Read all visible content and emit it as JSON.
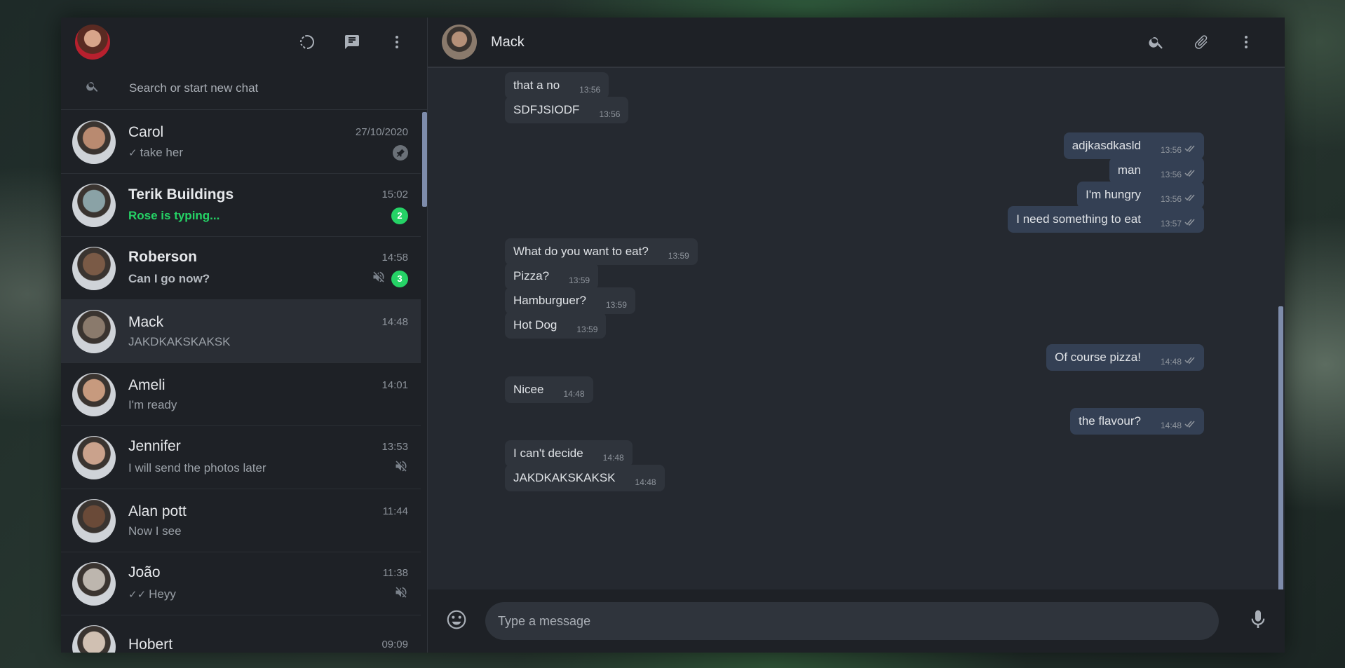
{
  "left": {
    "search_placeholder": "Search or start new chat",
    "chats": [
      {
        "name": "Carol",
        "time": "27/10/2020",
        "preview": "take her",
        "tick": "✓",
        "pinned": true,
        "color": "#b98a70"
      },
      {
        "name": "Terik Buildings",
        "time": "15:02",
        "preview": "Rose is typing...",
        "typing": true,
        "badge": "2",
        "bold": true,
        "color": "#8aa2a6"
      },
      {
        "name": "Roberson",
        "time": "14:58",
        "preview": "Can I go now?",
        "badge": "3",
        "muted": true,
        "bold": true,
        "color": "#7a5a46"
      },
      {
        "name": "Mack",
        "time": "14:48",
        "preview": "JAKDKAKSKAKSK",
        "active": true,
        "color": "#8a7a6c"
      },
      {
        "name": "Ameli",
        "time": "14:01",
        "preview": "I'm ready",
        "color": "#c79a7e"
      },
      {
        "name": "Jennifer",
        "time": "13:53",
        "preview": "I will send the photos later",
        "muted": true,
        "color": "#caa28c"
      },
      {
        "name": "Alan pott",
        "time": "11:44",
        "preview": "Now I see",
        "color": "#6a4a38"
      },
      {
        "name": "João",
        "time": "11:38",
        "preview": "Heyy",
        "tick": "✓✓",
        "muted": true,
        "color": "#bdb6ae"
      },
      {
        "name": "Hobert",
        "time": "09:09",
        "preview": "",
        "color": "#d0c0b2"
      }
    ]
  },
  "chat": {
    "title": "Mack",
    "composer_placeholder": "Type a message",
    "messages": [
      {
        "text": "that a no",
        "time": "13:56",
        "out": false
      },
      {
        "text": "SDFJSIODF",
        "time": "13:56",
        "out": false
      },
      {
        "text": "adjkasdkasld",
        "time": "13:56",
        "out": true
      },
      {
        "text": "man",
        "time": "13:56",
        "out": true
      },
      {
        "text": "I'm hungry",
        "time": "13:56",
        "out": true
      },
      {
        "text": "I need something to eat",
        "time": "13:57",
        "out": true
      },
      {
        "text": "What do you want to eat?",
        "time": "13:59",
        "out": false
      },
      {
        "text": "Pizza?",
        "time": "13:59",
        "out": false
      },
      {
        "text": "Hamburguer?",
        "time": "13:59",
        "out": false
      },
      {
        "text": "Hot Dog",
        "time": "13:59",
        "out": false
      },
      {
        "text": "Of course pizza!",
        "time": "14:48",
        "out": true
      },
      {
        "text": "Nicee",
        "time": "14:48",
        "out": false
      },
      {
        "text": "the flavour?",
        "time": "14:48",
        "out": true
      },
      {
        "text": "I can't decide",
        "time": "14:48",
        "out": false
      },
      {
        "text": "JAKDKAKSKAKSK",
        "time": "14:48",
        "out": false
      }
    ]
  }
}
